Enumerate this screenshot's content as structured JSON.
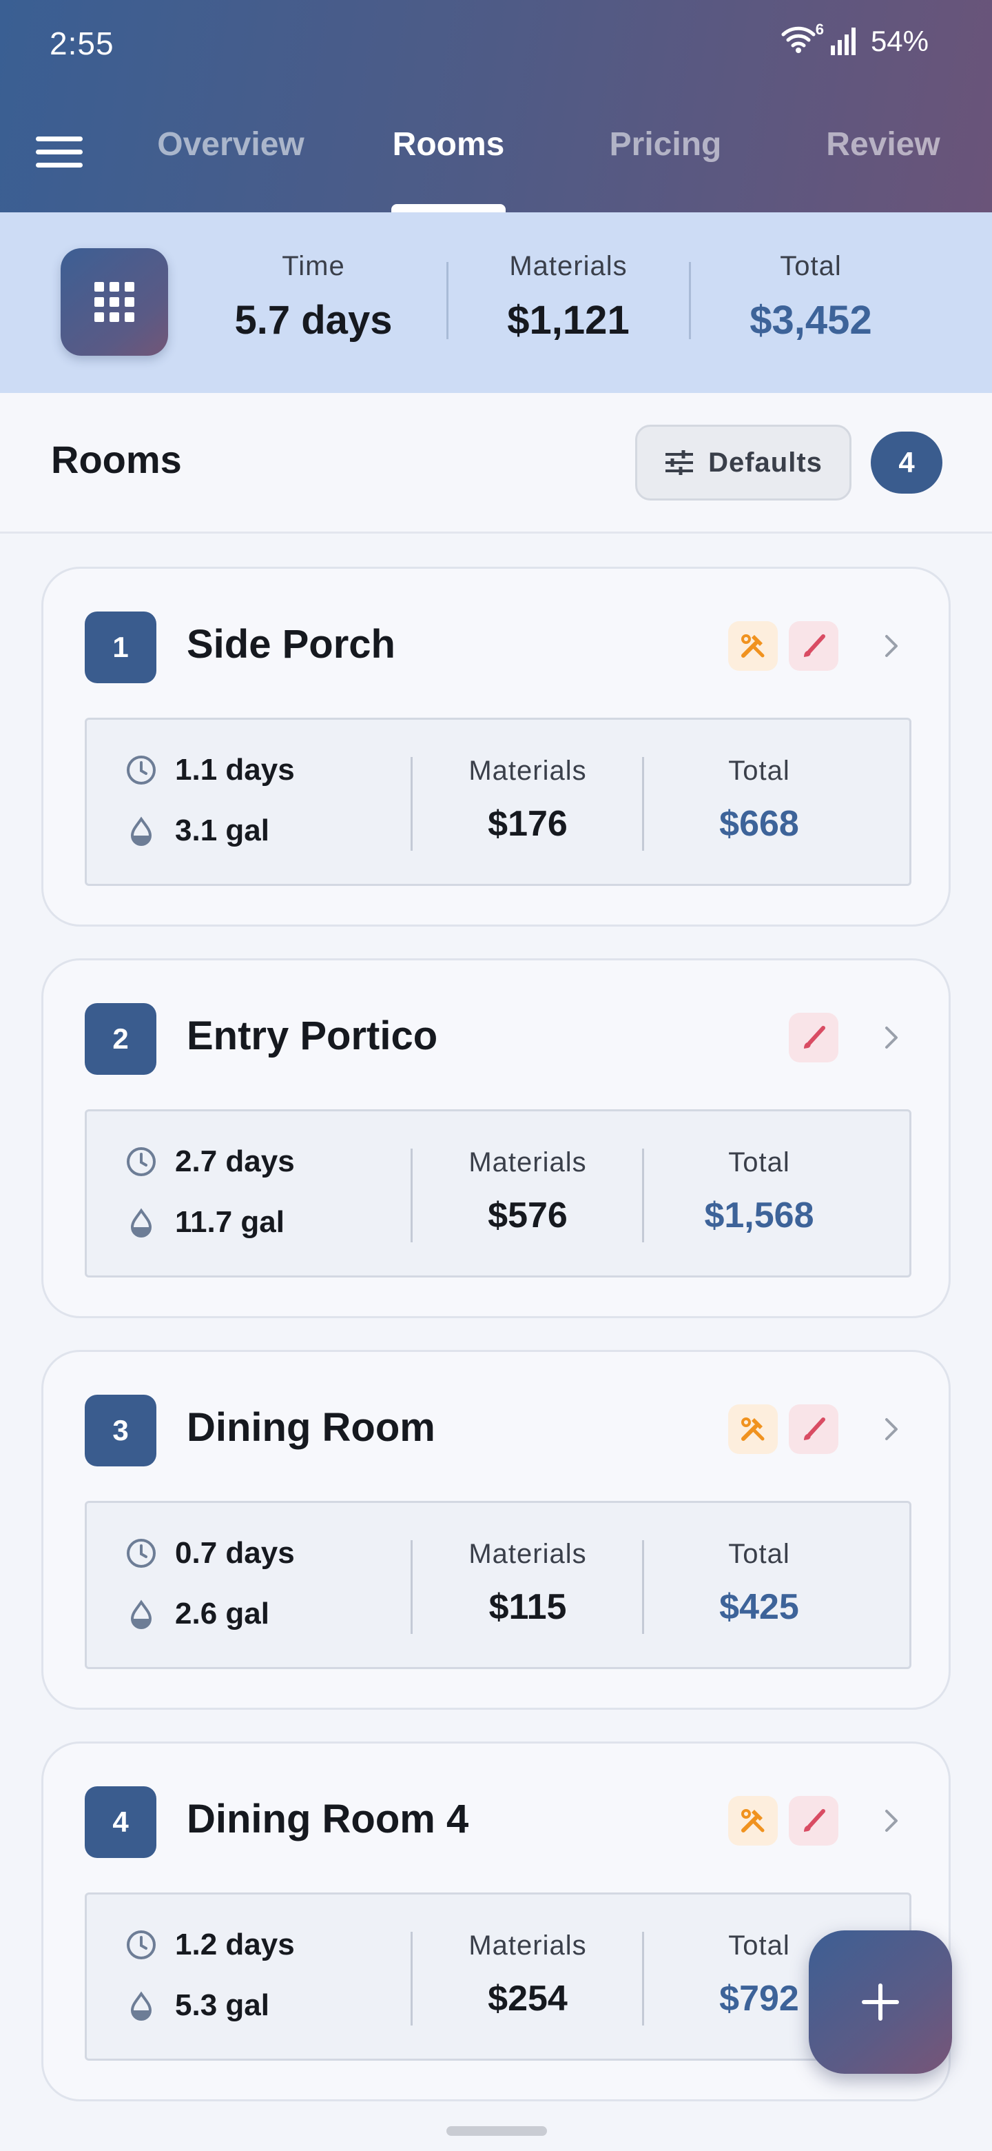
{
  "status_bar": {
    "time": "2:55",
    "wifi_badge": "6",
    "battery": "54%"
  },
  "nav": {
    "tabs": [
      {
        "label": "Overview",
        "active": false
      },
      {
        "label": "Rooms",
        "active": true
      },
      {
        "label": "Pricing",
        "active": false
      },
      {
        "label": "Review",
        "active": false
      }
    ]
  },
  "summary": {
    "time_label": "Time",
    "time_value": "5.7 days",
    "materials_label": "Materials",
    "materials_value": "$1,121",
    "total_label": "Total",
    "total_value": "$3,452"
  },
  "section": {
    "title": "Rooms",
    "defaults_label": "Defaults",
    "count": "4"
  },
  "rooms": [
    {
      "number": "1",
      "name": "Side Porch",
      "has_tools": true,
      "has_brush": true,
      "days": "1.1 days",
      "gallons": "3.1 gal",
      "materials_label": "Materials",
      "materials": "$176",
      "total_label": "Total",
      "total": "$668"
    },
    {
      "number": "2",
      "name": "Entry Portico",
      "has_tools": false,
      "has_brush": true,
      "days": "2.7 days",
      "gallons": "11.7 gal",
      "materials_label": "Materials",
      "materials": "$576",
      "total_label": "Total",
      "total": "$1,568"
    },
    {
      "number": "3",
      "name": "Dining Room",
      "has_tools": true,
      "has_brush": true,
      "days": "0.7 days",
      "gallons": "2.6 gal",
      "materials_label": "Materials",
      "materials": "$115",
      "total_label": "Total",
      "total": "$425"
    },
    {
      "number": "4",
      "name": "Dining Room 4",
      "has_tools": true,
      "has_brush": true,
      "days": "1.2 days",
      "gallons": "5.3 gal",
      "materials_label": "Materials",
      "materials": "$254",
      "total_label": "Total",
      "total": "$792"
    }
  ],
  "colors": {
    "primary": "#3a5c8e",
    "accent_value": "#3d6399",
    "tools_icon": "#f0921f",
    "brush_icon": "#d94c63"
  },
  "icons": {
    "menu": "hamburger-icon",
    "grid": "grid-icon",
    "defaults": "sliders-icon",
    "time": "clock-icon",
    "paint": "paint-drop-icon",
    "tools": "hammer-wrench-icon",
    "brush": "paintbrush-icon",
    "chevron": "chevron-right-icon",
    "add": "plus-icon"
  }
}
